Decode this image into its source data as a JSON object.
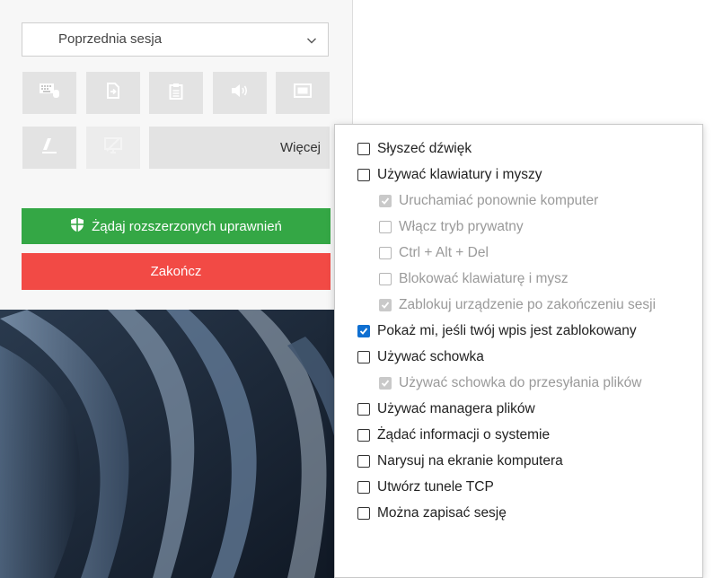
{
  "session_select": {
    "value": "Poprzednia sesja",
    "icon": "chevron-down-icon"
  },
  "toolbar": {
    "buttons": [
      {
        "icon": "keyboard-icon",
        "disabled": false
      },
      {
        "icon": "send-file-icon",
        "disabled": false
      },
      {
        "icon": "clipboard-icon",
        "disabled": false
      },
      {
        "icon": "speaker-icon",
        "disabled": false
      },
      {
        "icon": "screen-icon",
        "disabled": false
      },
      {
        "icon": "draw-pen-icon",
        "disabled": false
      },
      {
        "icon": "monitor-disabled-icon",
        "disabled": true
      }
    ],
    "more_label": "Więcej"
  },
  "actions": {
    "elevate_label": "Żądaj rozszerzonych uprawnień",
    "elevate_icon": "shield-icon",
    "end_label": "Zakończ"
  },
  "colors": {
    "green": "#34a745",
    "red": "#f24a45",
    "checkbox_blue": "#0f6fd1"
  },
  "menu": {
    "items": [
      {
        "label": "Słyszeć dźwięk",
        "level": 0,
        "checked": false,
        "disabled": false
      },
      {
        "label": "Używać klawiatury i myszy",
        "level": 0,
        "checked": false,
        "disabled": false
      },
      {
        "label": "Uruchamiać ponownie komputer",
        "level": 1,
        "checked": true,
        "disabled": true
      },
      {
        "label": "Włącz tryb prywatny",
        "level": 1,
        "checked": false,
        "disabled": true
      },
      {
        "label": "Ctrl + Alt + Del",
        "level": 1,
        "checked": false,
        "disabled": true
      },
      {
        "label": "Blokować klawiaturę i mysz",
        "level": 1,
        "checked": false,
        "disabled": true
      },
      {
        "label": "Zablokuj urządzenie po zakończeniu sesji",
        "level": 1,
        "checked": true,
        "disabled": true
      },
      {
        "label": "Pokaż mi, jeśli twój wpis jest zablokowany",
        "level": 0,
        "checked": true,
        "disabled": false
      },
      {
        "label": "Używać schowka",
        "level": 0,
        "checked": false,
        "disabled": false
      },
      {
        "label": "Używać schowka do przesyłania plików",
        "level": 1,
        "checked": true,
        "disabled": true
      },
      {
        "label": "Używać managera plików",
        "level": 0,
        "checked": false,
        "disabled": false
      },
      {
        "label": "Żądać informacji o systemie",
        "level": 0,
        "checked": false,
        "disabled": false
      },
      {
        "label": "Narysuj na ekranie komputera",
        "level": 0,
        "checked": false,
        "disabled": false
      },
      {
        "label": "Utwórz tunele TCP",
        "level": 0,
        "checked": false,
        "disabled": false
      },
      {
        "label": "Można zapisać sesję",
        "level": 0,
        "checked": false,
        "disabled": false
      }
    ]
  }
}
